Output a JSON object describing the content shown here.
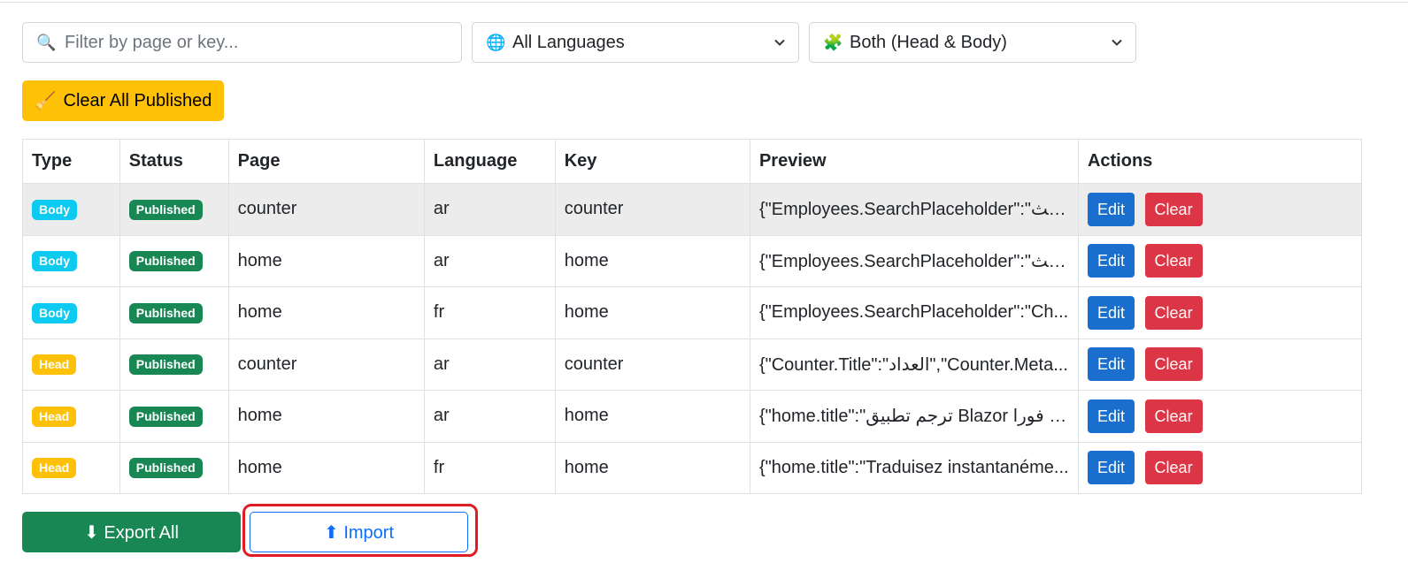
{
  "filters": {
    "search_placeholder": "Filter by page or key...",
    "search_icon": "🔍",
    "language_icon": "🌐",
    "language_value": "All Languages",
    "scope_icon": "🧩",
    "scope_value": "Both (Head & Body)"
  },
  "clear_all": {
    "icon": "🧹",
    "label": "Clear All Published"
  },
  "table": {
    "headers": [
      "Type",
      "Status",
      "Page",
      "Language",
      "Key",
      "Preview",
      "Actions"
    ],
    "rows": [
      {
        "type": "Body",
        "status": "Published",
        "page": "counter",
        "language": "ar",
        "key": "counter",
        "preview": "{\"Employees.SearchPlaceholder\":\"ابحث..."
      },
      {
        "type": "Body",
        "status": "Published",
        "page": "home",
        "language": "ar",
        "key": "home",
        "preview": "{\"Employees.SearchPlaceholder\":\"ابحث..."
      },
      {
        "type": "Body",
        "status": "Published",
        "page": "home",
        "language": "fr",
        "key": "home",
        "preview": "{\"Employees.SearchPlaceholder\":\"Ch..."
      },
      {
        "type": "Head",
        "status": "Published",
        "page": "counter",
        "language": "ar",
        "key": "counter",
        "preview": "{\"Counter.Title\":\"العداد\",\"Counter.Meta..."
      },
      {
        "type": "Head",
        "status": "Published",
        "page": "home",
        "language": "ar",
        "key": "home",
        "preview": "{\"home.title\":\"ترجم تطبيق Blazor بك فورا..."
      },
      {
        "type": "Head",
        "status": "Published",
        "page": "home",
        "language": "fr",
        "key": "home",
        "preview": "{\"home.title\":\"Traduisez instantanéme..."
      }
    ],
    "edit_label": "Edit",
    "clear_label": "Clear"
  },
  "footer": {
    "export_label": "⬇ Export All",
    "import_label": "⬆ Import"
  },
  "colors": {
    "body_badge": "#0dcaf0",
    "head_badge": "#ffc107",
    "published_badge": "#198754",
    "edit_button": "#1a6fce",
    "clear_button": "#dc3545",
    "highlight_outline": "#e01b24"
  }
}
